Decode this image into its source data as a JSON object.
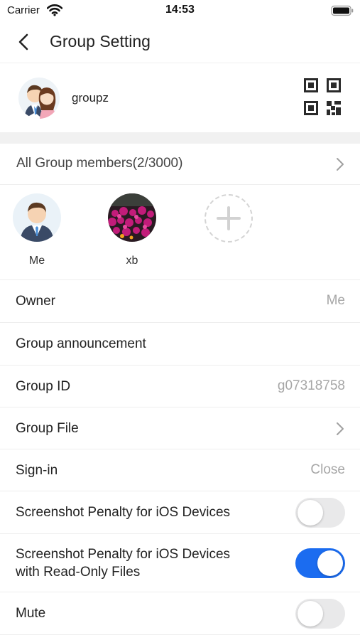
{
  "status_bar": {
    "carrier": "Carrier",
    "time": "14:53",
    "icons": [
      "wifi-icon",
      "battery-icon"
    ]
  },
  "nav": {
    "back_icon": "chevron-left-icon",
    "title": "Group Setting"
  },
  "group": {
    "name": "groupz",
    "avatar_icon": "couple-avatar",
    "qr_icon": "qr-code-icon"
  },
  "members": {
    "label": "All Group members(2/3000)",
    "list": [
      {
        "name": "Me",
        "avatar": "businessman-avatar"
      },
      {
        "name": "xb",
        "avatar": "flower-photo-avatar"
      }
    ],
    "add_icon": "plus-icon"
  },
  "settings": [
    {
      "label": "Owner",
      "value": "Me"
    },
    {
      "label": "Group announcement",
      "value": ""
    },
    {
      "label": "Group ID",
      "value": "g07318758"
    },
    {
      "label": "Group File",
      "value": ""
    },
    {
      "label": "Sign-in",
      "value": "Close"
    },
    {
      "label": "Screenshot Penalty for iOS Devices",
      "toggle": false
    },
    {
      "label_lines": [
        "Screenshot Penalty for iOS Devices",
        "with Read-Only Files"
      ],
      "toggle": true
    },
    {
      "label": "Mute",
      "toggle": false
    }
  ],
  "colors": {
    "toggle_on": "#1b6cf0",
    "toggle_off": "#e9e9ea",
    "section_gap": "#f1f1f1",
    "muted_text": "#a6a6a6"
  }
}
